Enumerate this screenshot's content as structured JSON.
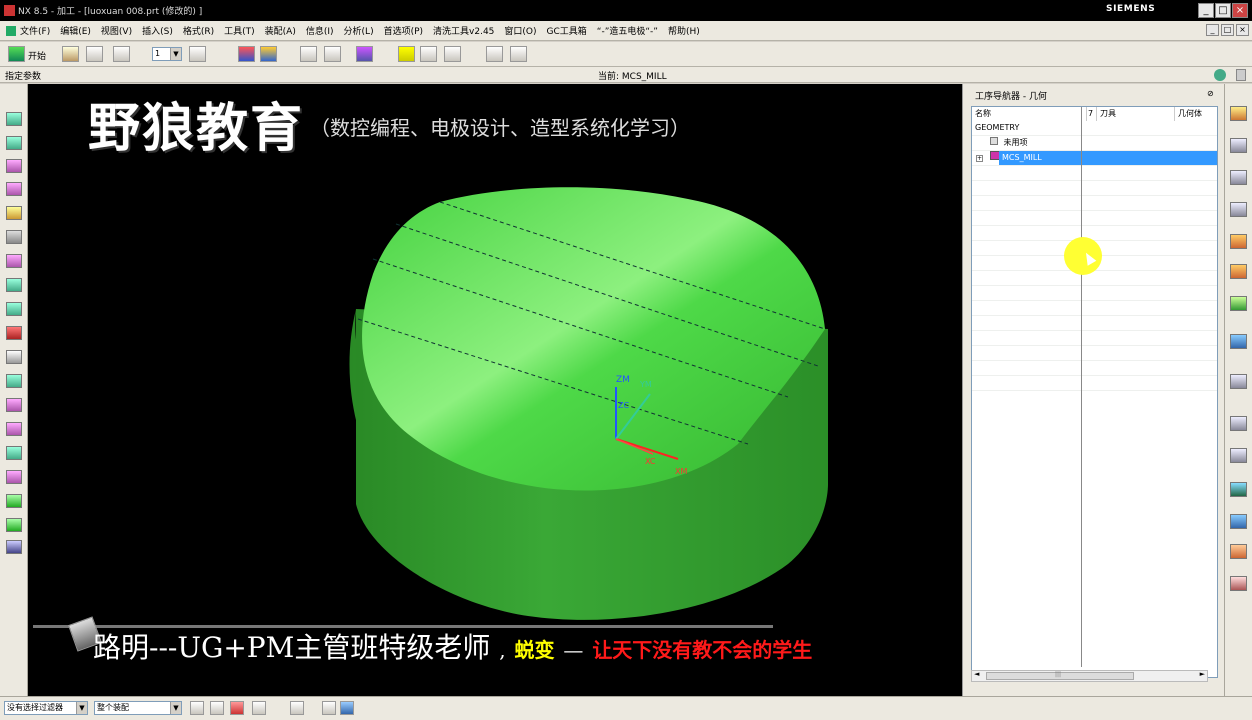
{
  "window": {
    "title": "NX 8.5 - 加工 - [luoxuan 008.prt (修改的) ]",
    "brand": "SIEMENS",
    "controls": {
      "minimize": "_",
      "maximize": "□",
      "close": "×"
    }
  },
  "menu": {
    "items": [
      "文件(F)",
      "编辑(E)",
      "视图(V)",
      "插入(S)",
      "格式(R)",
      "工具(T)",
      "装配(A)",
      "信息(I)",
      "分析(L)",
      "首选项(P)",
      "清洗工具v2.45",
      "窗口(O)",
      "GC工具箱",
      "“-”造五电极“-”",
      "帮助(H)"
    ],
    "right_controls": [
      "_",
      "□",
      "×"
    ]
  },
  "toolbar": {
    "start_label": "开始",
    "count_value": "1"
  },
  "statusrow": {
    "left": "指定参数",
    "center": "当前: MCS_MILL"
  },
  "viewport": {
    "overlay_title": "野狼教育",
    "overlay_subtitle": "（数控编程、电极设计、造型系统化学习）",
    "lower_teacher": "路明---UG+PM主管班特级老师",
    "lower_tag": "蜕变",
    "lower_dash": "—",
    "lower_slogan": "让天下没有教不会的学生",
    "axes": {
      "zm": "ZM",
      "zc": "ZC",
      "ym": "YM",
      "xc": "XC",
      "xm": "XM"
    },
    "colors": {
      "part_top": "#4fd94a",
      "part_side": "#2f9a2c",
      "background": "#000000",
      "slogan": "#ff1a1a",
      "tag": "#ffff00"
    }
  },
  "navigator": {
    "title": "工序导航器 - 几何",
    "pin": "⊘",
    "columns": [
      "名称",
      "7",
      "刀具",
      "几何体"
    ],
    "rows": [
      {
        "label": "GEOMETRY",
        "indent": 0
      },
      {
        "label": "未用项",
        "indent": 1
      },
      {
        "label": "MCS_MILL",
        "indent": 1,
        "selected": true
      }
    ],
    "scroll_left": "◄",
    "scroll_right": "►",
    "scroll_grip": "|||"
  },
  "bottombar": {
    "filter": "没有选择过滤器",
    "scope": "整个装配"
  }
}
